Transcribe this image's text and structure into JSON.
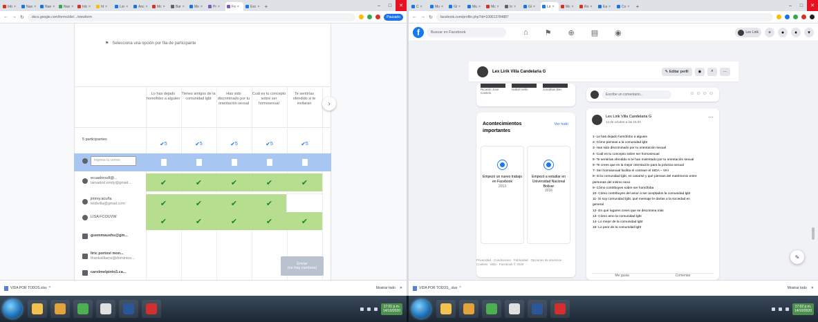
{
  "left_browser": {
    "tabs": [
      {
        "label": "Inb",
        "color": "#d93025"
      },
      {
        "label": "Nue",
        "color": "#1a73e8"
      },
      {
        "label": "Nue",
        "color": "#1a73e8"
      },
      {
        "label": "Nue",
        "color": "#34a853"
      },
      {
        "label": "Inb",
        "color": "#d93025"
      },
      {
        "label": "ht",
        "color": "#fbbc04"
      },
      {
        "label": "Lor",
        "color": "#1a73e8"
      },
      {
        "label": "Anc",
        "color": "#1a73e8"
      },
      {
        "label": "Mc",
        "color": "#d93025"
      },
      {
        "label": "Bar",
        "color": "#5f6368"
      },
      {
        "label": "Mo",
        "color": "#1a73e8"
      },
      {
        "label": "Pr",
        "color": "#7e57c2"
      },
      {
        "label": "Fo",
        "color": "#7e57c2",
        "active": true
      },
      {
        "label": "Esc",
        "color": "#1877f2"
      }
    ],
    "address": "docs.google.com/forms/d/e/.../viewform",
    "profile_label": "Pausado",
    "download_file": "VIDA POR TODOS.xlsx",
    "download_show_all": "Mostrar todo"
  },
  "form": {
    "hint": "Selecciona una opción por fila de participante",
    "columns": [
      "Lo has dejado homófobo a alguien",
      "Tienes amigos de la comunidad lgbt",
      "Has sido discriminado por tu orientación sexual",
      "Cuál es tu concepto sobre ser homosexual",
      "Te sentirías ofendido si te invitaran"
    ],
    "participants_label": "5 participantes",
    "participant_counts": [
      "5",
      "5",
      "5",
      "5",
      "5"
    ],
    "rows": [
      {
        "name": "Ingresa tu correo",
        "type": "input",
        "checks": [
          false,
          false,
          false,
          false,
          false
        ]
      },
      {
        "name": "ecuadorsv8@...",
        "sub": "lamadrid.emily@gmail...",
        "type": "done",
        "checks": [
          true,
          true,
          true,
          true,
          true
        ]
      },
      {
        "name": "jimmy.acuña",
        "sub": "leidivilla@gmail.com",
        "type": "done",
        "checks": [
          true,
          true,
          true,
          true,
          false
        ]
      },
      {
        "name": "LISA FCOUVW",
        "sub": "",
        "type": "done",
        "checks": [
          true,
          true,
          true,
          true,
          true
        ]
      },
      {
        "name": "guemmaushu@gm...",
        "sub": "",
        "type": "pending",
        "checks": [
          false,
          false,
          false,
          false,
          false
        ]
      },
      {
        "name": "liric portovi mon...",
        "sub": "thanksilliams@dominios...",
        "type": "pending",
        "checks": [
          false,
          false,
          false,
          false,
          false
        ]
      },
      {
        "name": "carolmelpinto3.ca...",
        "sub": "",
        "type": "pending",
        "checks": [
          false,
          false,
          false,
          false,
          false
        ]
      }
    ],
    "submit_label": "Enviar",
    "submit_sub": "(no hay cambios)"
  },
  "right_browser": {
    "tabs": [
      {
        "label": "C",
        "color": "#1a73e8"
      },
      {
        "label": "Mu",
        "color": "#1877f2"
      },
      {
        "label": "Gl",
        "color": "#1877f2"
      },
      {
        "label": "Mu",
        "color": "#1a73e8"
      },
      {
        "label": "Mc",
        "color": "#d93025"
      },
      {
        "label": "In",
        "color": "#5f6368"
      },
      {
        "label": "Gi",
        "color": "#1a73e8"
      },
      {
        "label": "Lir",
        "color": "#1877f2",
        "active": true
      },
      {
        "label": "Mc",
        "color": "#d93025"
      },
      {
        "label": "Ro",
        "color": "#d93025"
      },
      {
        "label": "Ea",
        "color": "#1a73e8"
      },
      {
        "label": "Co",
        "color": "#1a73e8"
      }
    ],
    "address": "facebook.com/profile.php?id=100013784887",
    "download_file": "VIDA POR TODOS_.xlsx",
    "download_show_all": "Mostrar todo"
  },
  "facebook": {
    "search_placeholder": "Buscar en Facebook",
    "profile_name": "Lex Lirik Villa Candelaria G",
    "me_label": "Lex Lirik",
    "edit_profile": "Editar perfil",
    "friends": [
      "Ricardo Jose Castelo",
      "Isabel Hello",
      "Jonathan Bec"
    ],
    "events_title": "Acontecimientos importantes",
    "events_link": "Ver todo",
    "events": [
      {
        "text": "Empezó un nuevo trabajo en Facebook",
        "year": "2013"
      },
      {
        "text": "Empezó a estudiar en Universidad Nacional Bolivar",
        "year": "2016"
      }
    ],
    "footer": "Privacidad · Condiciones · Publicidad · Opciones de anuncios · Cookies · Más · Facebook © 2020",
    "compose_placeholder": "Escribe un comentario...",
    "post": {
      "author": "Lex Lirik Villa Candelaria G",
      "date": "14 de octubre a las 15:20",
      "lines": [
        "1- Le has dejado homófobo a alguien",
        "2- Cómo piensas a la comunidad lgbt",
        "3- Has sido discriminado por tu orientación sexual",
        "4- Cuál es tu concepto sobre ser homosexual",
        "5- Te sentirías ofendido si te han molestado por tu orientación sexual",
        "6- Te crees que es la mejor orientación para la práctica sexual",
        "7- Ser homosexual facilita el contraer el SIDA – VIH",
        "8- Si la comunidad lgbt, es casarse y qué piensas del matrimonio entre",
        "personas del mismo sexo",
        "9- Cómo contribuyes sobre ser homófoba",
        "10- Cómo contribuyes del amor a ser aceptados la comunidad lgbt",
        "11- Si soy comunidad lgbt, qué mensaje le darías a la sociedad en",
        "general",
        "12- En qué lugares crees que se discrimina más",
        "13- Cómo amo la comunidad lgbt",
        "14- Lo mejor de la comunidad lgbt",
        "15- Lo peor de la comunidad lgbt"
      ],
      "highlight_word": "Te crees",
      "react_like": "Me gusta",
      "react_comment": "Comentar"
    }
  },
  "taskbar": {
    "apps": [
      {
        "name": "explorer",
        "color": "#f2c14e"
      },
      {
        "name": "folder",
        "color": "#e3a33a"
      },
      {
        "name": "chrome",
        "color": "#4caf50"
      },
      {
        "name": "media",
        "color": "#e0e0e0"
      },
      {
        "name": "word",
        "color": "#2b579a"
      },
      {
        "name": "pdf",
        "color": "#d32f2f"
      }
    ],
    "clock_left": "17:01 p.m.",
    "date_left": "14/10/2020",
    "clock_right": "17:02 p.m.",
    "date_right": "14/10/2020"
  }
}
